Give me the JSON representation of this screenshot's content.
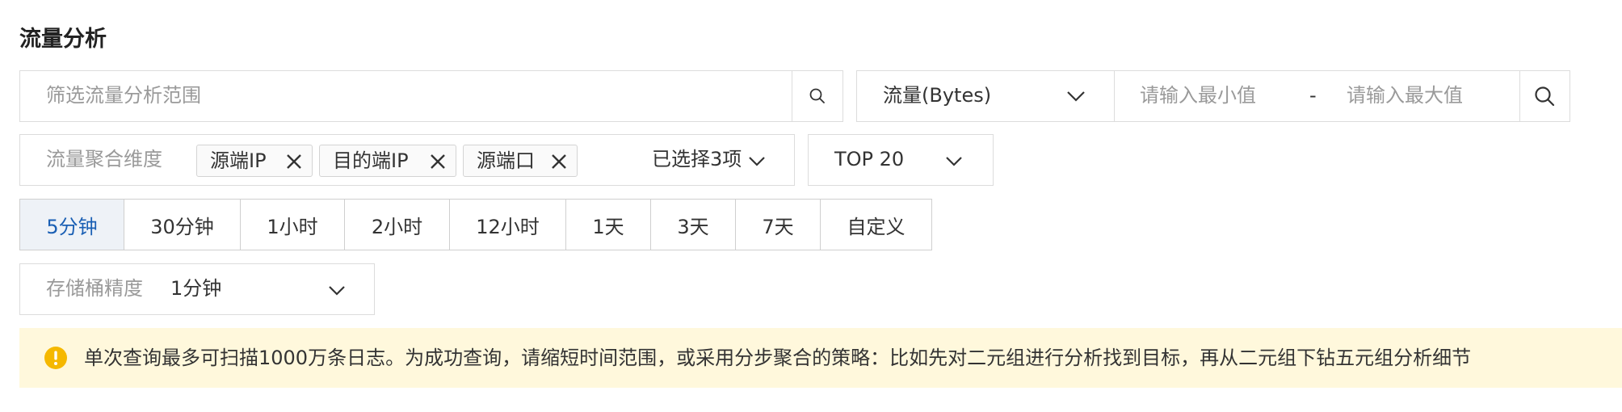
{
  "page": {
    "title": "流量分析"
  },
  "scope_search": {
    "placeholder": "筛选流量分析范围",
    "icon": "search-icon"
  },
  "metric": {
    "selected": "流量(Bytes)",
    "min_placeholder": "请输入最小值",
    "range_separator": "-",
    "max_placeholder": "请输入最大值",
    "search_icon": "search-icon"
  },
  "dimension": {
    "label": "流量聚合维度",
    "tags": [
      {
        "label": "源端IP"
      },
      {
        "label": "目的端IP"
      },
      {
        "label": "源端口"
      }
    ],
    "summary": "已选择3项"
  },
  "top_select": {
    "selected": "TOP 20"
  },
  "time_range": {
    "options": [
      "5分钟",
      "30分钟",
      "1小时",
      "2小时",
      "12小时",
      "1天",
      "3天",
      "7天",
      "自定义"
    ],
    "active": "5分钟"
  },
  "bucket": {
    "label": "存储桶精度",
    "selected": "1分钟"
  },
  "notice": {
    "icon": "warning-icon",
    "text": "单次查询最多可扫描1000万条日志。为成功查询，请缩短时间范围，或采用分步聚合的策略：比如先对二元组进行分析找到目标，再从二元组下钻五元组分析细节"
  },
  "colors": {
    "accent": "#1a5fb4",
    "warning": "#f5b800",
    "notice_bg": "#fff8dc",
    "border": "#dcdcdc"
  }
}
